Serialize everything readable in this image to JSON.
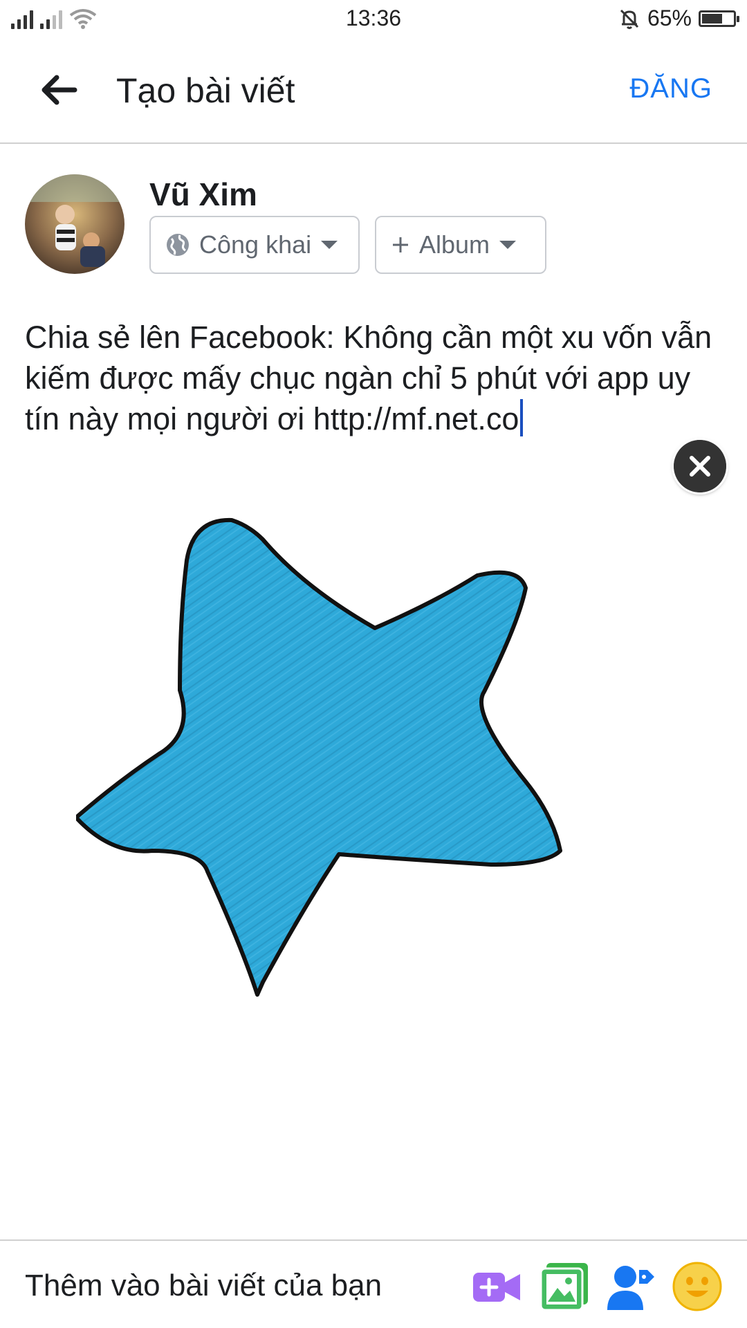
{
  "status_bar": {
    "time": "13:36",
    "battery_percent": "65%",
    "battery_level": 0.65,
    "icons": [
      "signal-icon",
      "signal-icon",
      "wifi-icon",
      "bell-off-icon",
      "battery-icon"
    ]
  },
  "header": {
    "back_icon": "arrow-left-icon",
    "title": "Tạo bài viết",
    "post_label": "ĐĂNG",
    "accent_color": "#1877f2"
  },
  "author": {
    "name": "Vũ Xim",
    "privacy_label": "Công khai",
    "privacy_icon": "globe-icon",
    "album_label": "Album",
    "album_icon": "plus-icon"
  },
  "composer": {
    "text": "Chia sẻ lên Facebook: Không cần một xu vốn vẫn kiếm được mấy chục ngàn chỉ 5 phút với app uy tín này mọi người ơi http://mf.net.co"
  },
  "attachment": {
    "image": "blue-star-drawing",
    "star_color": "#2ea9d9",
    "close_icon": "close-icon"
  },
  "bottom_bar": {
    "label": "Thêm vào bài viết của bạn",
    "icons": [
      "video-icon",
      "photo-icon",
      "tag-people-icon",
      "emoji-icon"
    ]
  }
}
